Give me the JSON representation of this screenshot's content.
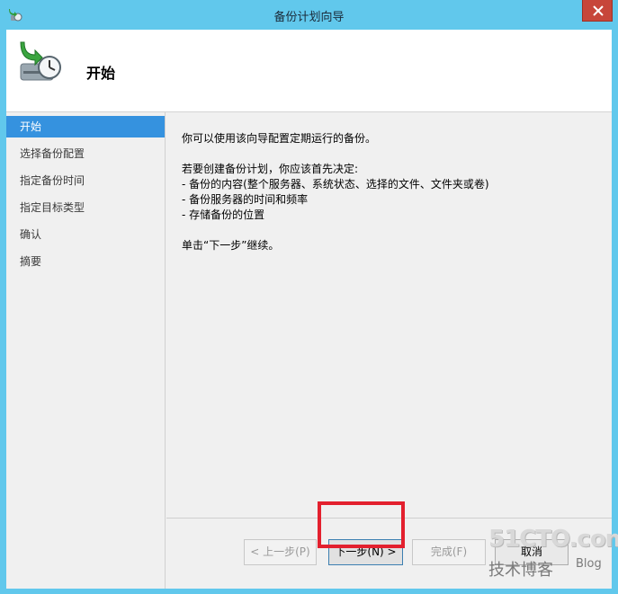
{
  "window": {
    "title": "备份计划向导"
  },
  "header": {
    "title": "开始"
  },
  "sidebar": {
    "items": [
      {
        "label": "开始",
        "active": true
      },
      {
        "label": "选择备份配置",
        "active": false
      },
      {
        "label": "指定备份时间",
        "active": false
      },
      {
        "label": "指定目标类型",
        "active": false
      },
      {
        "label": "确认",
        "active": false
      },
      {
        "label": "摘要",
        "active": false
      }
    ]
  },
  "content": {
    "intro": "你可以使用该向导配置定期运行的备份。",
    "decide_heading": "若要创建备份计划，你应该首先决定:",
    "bullets": [
      "- 备份的内容(整个服务器、系统状态、选择的文件、文件夹或卷)",
      "- 备份服务器的时间和频率",
      "- 存储备份的位置"
    ],
    "continue_hint": "单击“下一步”继续。"
  },
  "buttons": {
    "prev": "< 上一步(P)",
    "next": "下一步(N) >",
    "finish": "完成(F)",
    "cancel": "取消"
  },
  "watermark": {
    "main": "51CTO.com",
    "sub": "技术博客",
    "blog": "Blog"
  },
  "colors": {
    "titlebar": "#61c8ec",
    "active_nav": "#3592df",
    "highlight": "#e3202e",
    "close": "#c7463a"
  }
}
